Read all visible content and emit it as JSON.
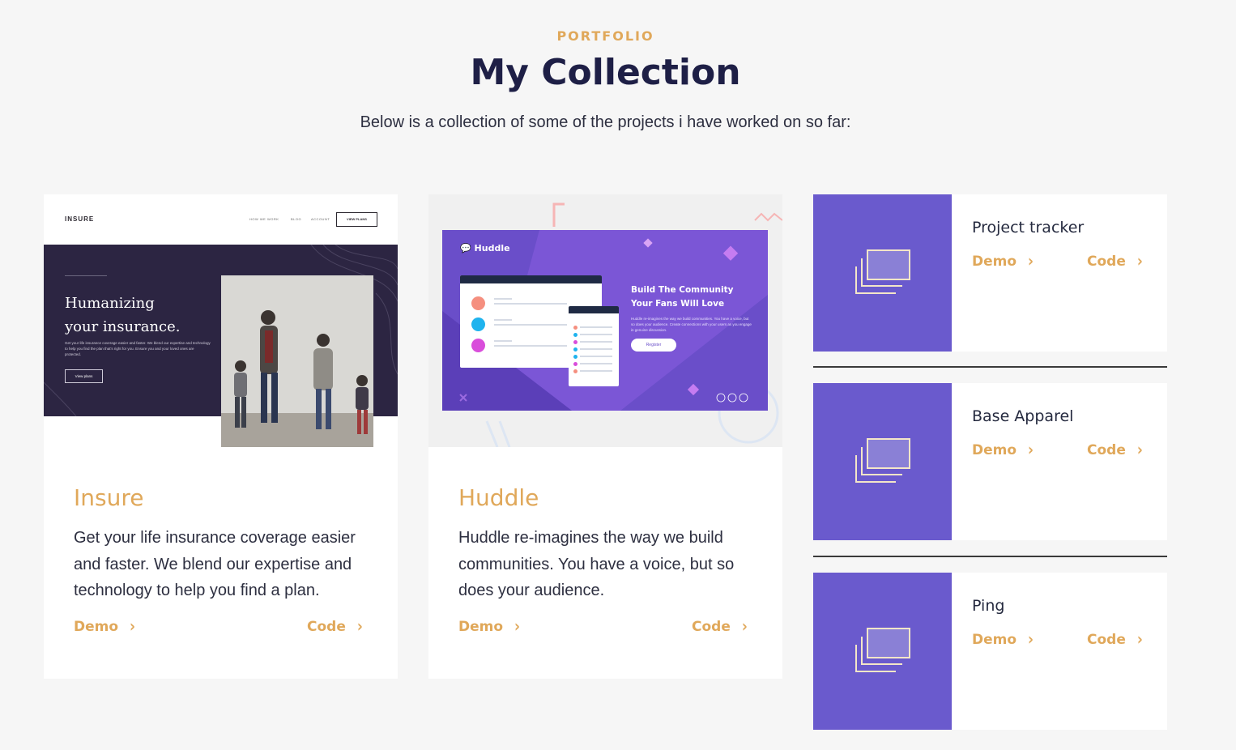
{
  "header": {
    "eyebrow": "PORTFOLIO",
    "title": "My Collection",
    "subtitle": "Below is a collection of some of the projects i have worked on so far:"
  },
  "colors": {
    "accent": "#e0a85a",
    "heading": "#1e1f46",
    "icon_tile": "#6a5acd",
    "huddle_bg": "#6a4ec9",
    "insure_hero": "#2c2542"
  },
  "projects": [
    {
      "name": "Insure",
      "description": "Get your life insurance coverage easier and faster. We blend our expertise and technology to help you find a plan.",
      "demo_label": "Demo",
      "code_label": "Code",
      "preview": {
        "logo": "INSURE",
        "menu": [
          "HOW WE WORK",
          "BLOG",
          "ACCOUNT"
        ],
        "cta": "VIEW PLANS",
        "headline_1": "Humanizing",
        "headline_2": "your insurance.",
        "body": "Get your life insurance coverage easier and faster. We blend our expertise and technology to help you find the plan that's right for you. Ensure you and your loved ones are protected.",
        "button": "View plans"
      }
    },
    {
      "name": "Huddle",
      "description": "Huddle re-imagines the way we build communities. You have a voice, but so does your audience.",
      "demo_label": "Demo",
      "code_label": "Code",
      "preview": {
        "logo": "Huddle",
        "headline_1": "Build The Community",
        "headline_2": "Your Fans Will Love",
        "body": "Huddle re-imagines the way we build communities. You have a voice, but so does your audience. Create connections with your users as you engage in genuine discussion.",
        "button": "Register"
      }
    }
  ],
  "small_projects": [
    {
      "name": "Project tracker",
      "demo_label": "Demo",
      "code_label": "Code",
      "icon": "gallery-icon"
    },
    {
      "name": "Base Apparel",
      "demo_label": "Demo",
      "code_label": "Code",
      "icon": "gallery-icon"
    },
    {
      "name": "Ping",
      "demo_label": "Demo",
      "code_label": "Code",
      "icon": "gallery-icon"
    }
  ]
}
